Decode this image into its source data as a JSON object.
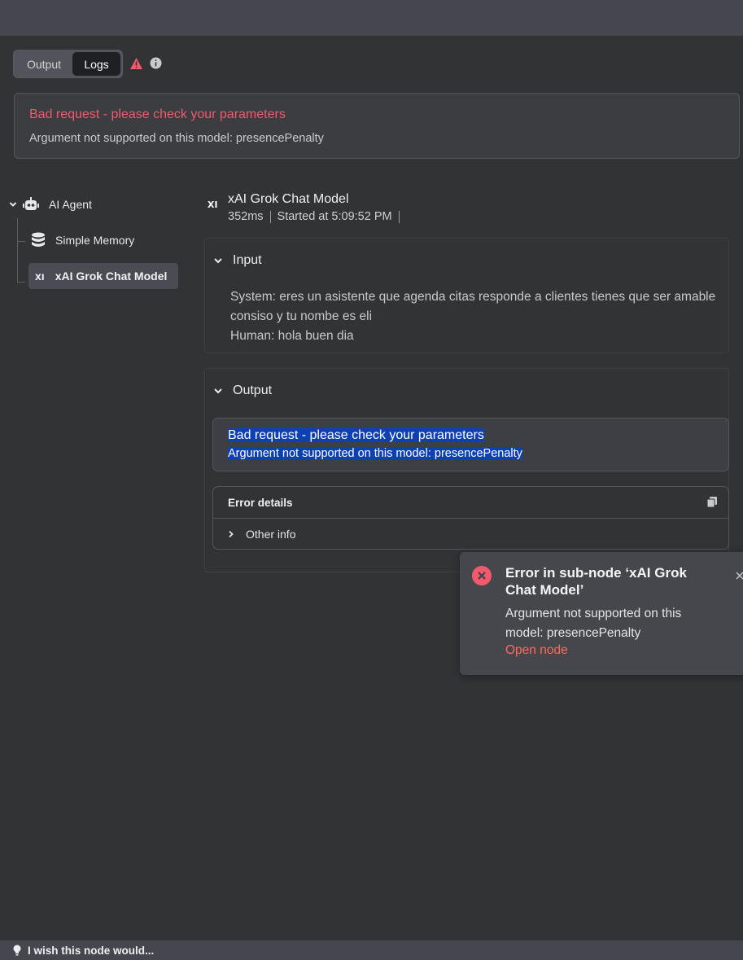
{
  "toggle": {
    "output_label": "Output",
    "logs_label": "Logs",
    "active": "Logs"
  },
  "banner": {
    "title": "Bad request - please check your parameters",
    "message": "Argument not supported on this model: presencePenalty"
  },
  "tree": {
    "agent_label": "AI Agent",
    "memory_label": "Simple Memory",
    "grok_label": "xAI Grok Chat Model",
    "grok_icon_text": "xı"
  },
  "node": {
    "icon_text": "xı",
    "title": "xAI Grok Chat Model",
    "duration": "352ms",
    "started": "Started at 5:09:52 PM"
  },
  "input": {
    "heading": "Input",
    "system_line": "System: eres un asistente que agenda citas responde a clientes tienes que ser amable consiso y tu nombe es eli",
    "human_line": "Human: hola buen dia"
  },
  "output": {
    "heading": "Output",
    "error_title": "Bad request - please check your parameters",
    "error_message": "Argument not supported on this model: presencePenalty",
    "details_heading": "Error details",
    "other_info": "Other info"
  },
  "toast": {
    "title": "Error in sub-node ‘xAI Grok Chat Model’",
    "message": "Argument not supported on this model: presencePenalty",
    "link": "Open node"
  },
  "bottom": {
    "text": "I wish this node would..."
  },
  "colors": {
    "error": "#f05a6c",
    "link": "#ff6b5a",
    "highlight": "#0d3fb5",
    "bg": "#323335"
  }
}
